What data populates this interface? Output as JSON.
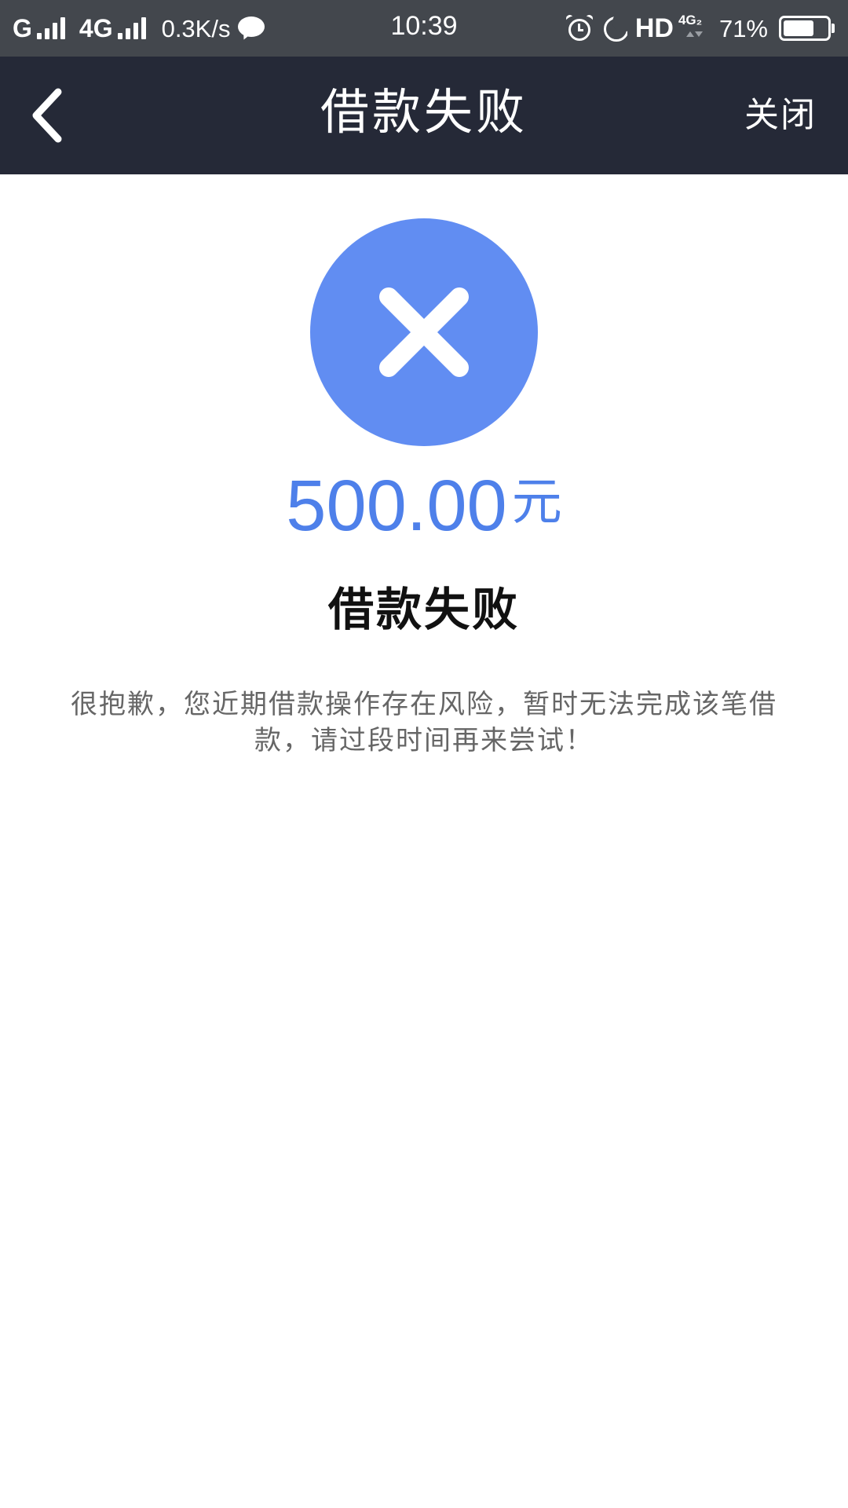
{
  "status_bar": {
    "carrier_1": "G",
    "carrier_2": "4G",
    "net_speed": "0.3K/s",
    "time": "10:39",
    "hd_label": "HD",
    "net_type": "4G₂",
    "battery_percent": "71%",
    "battery_level": 0.71,
    "icons": [
      "signal-icon",
      "chat-icon",
      "alarm-icon",
      "moon-icon",
      "battery-icon"
    ]
  },
  "nav": {
    "back_icon": "chevron-left-icon",
    "title": "借款失败",
    "close_label": "关闭"
  },
  "result": {
    "status_icon": "close-circle-icon",
    "amount": "500.00",
    "currency_unit": "元",
    "title": "借款失败",
    "message": "很抱歉，您近期借款操作存在风险，暂时无法完成该笔借款，请过段时间再来尝试！"
  },
  "colors": {
    "status_bar_bg": "#43474d",
    "nav_bg": "#252937",
    "accent_blue": "#618df2",
    "amount_blue": "#4e80ea",
    "title_text": "#111111",
    "desc_text": "#666666"
  }
}
